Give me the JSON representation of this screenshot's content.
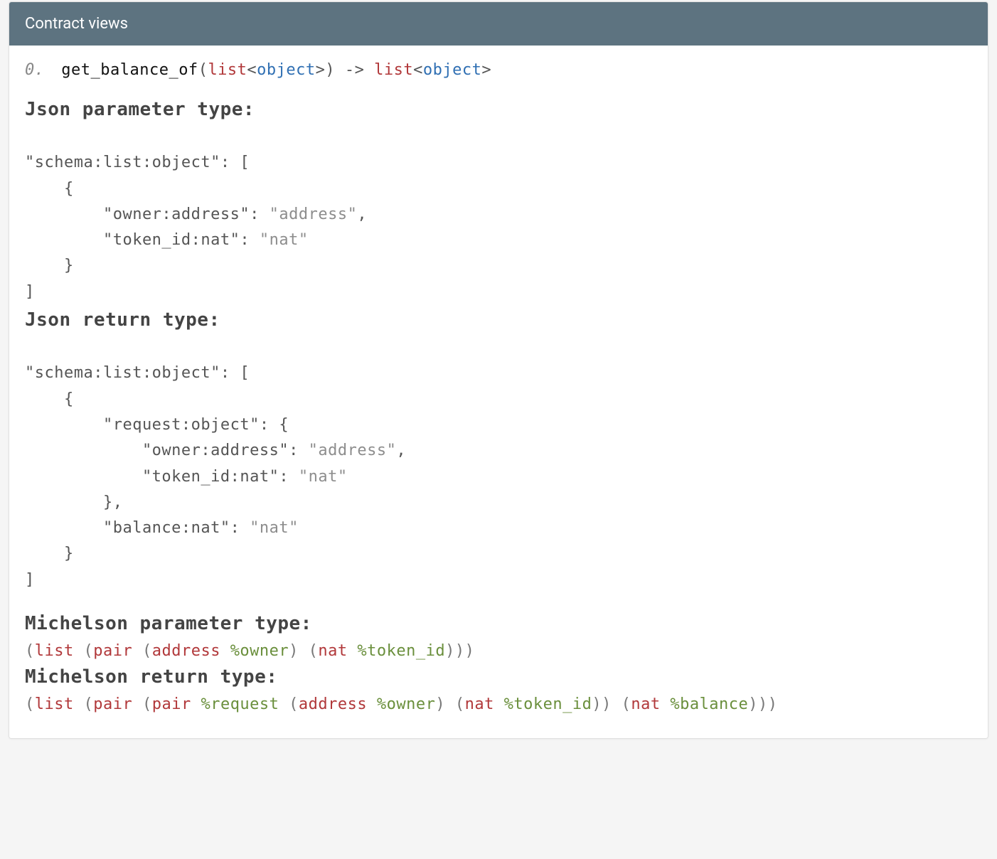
{
  "header": {
    "title": "Contract views"
  },
  "signature": {
    "index": "0.",
    "name": "get_balance_of",
    "p_open": "(",
    "p_close": ")",
    "list_kw": "list",
    "lt": "<",
    "gt": ">",
    "object_kw": "object",
    "arrow": " -> "
  },
  "sections": {
    "json_param_title": "Json parameter type:",
    "json_return_title": "Json return type:",
    "mich_param_title": "Michelson parameter type:",
    "mich_return_title": "Michelson return type:"
  },
  "json_param": {
    "l1a": "\"schema:list:object\"",
    "l1b": ": [",
    "l2": "    {",
    "l3a": "        \"owner:address\"",
    "l3b": ": ",
    "l3c": "\"address\"",
    "l3d": ",",
    "l4a": "        \"token_id:nat\"",
    "l4b": ": ",
    "l4c": "\"nat\"",
    "l5": "    }",
    "l6": "]"
  },
  "json_return": {
    "l1a": "\"schema:list:object\"",
    "l1b": ": [",
    "l2": "    {",
    "l3a": "        \"request:object\"",
    "l3b": ": {",
    "l4a": "            \"owner:address\"",
    "l4b": ": ",
    "l4c": "\"address\"",
    "l4d": ",",
    "l5a": "            \"token_id:nat\"",
    "l5b": ": ",
    "l5c": "\"nat\"",
    "l6": "        },",
    "l7a": "        \"balance:nat\"",
    "l7b": ": ",
    "l7c": "\"nat\"",
    "l8": "    }",
    "l9": "]"
  },
  "mich_param": {
    "t1": "(",
    "t2": "list",
    "t3": " (",
    "t4": "pair",
    "t5": " (",
    "t6": "address",
    "t7": " ",
    "t8": "%owner",
    "t9": ") (",
    "t10": "nat",
    "t11": " ",
    "t12": "%token_id",
    "t13": ")))"
  },
  "mich_return": {
    "t1": "(",
    "t2": "list",
    "t3": " (",
    "t4": "pair",
    "t5": " (",
    "t6": "pair",
    "t7": " ",
    "t8": "%request",
    "t9": " (",
    "t10": "address",
    "t11": " ",
    "t12": "%owner",
    "t13": ") (",
    "t14": "nat",
    "t15": " ",
    "t16": "%token_id",
    "t17": ")) (",
    "t18": "nat",
    "t19": " ",
    "t20": "%balance",
    "t21": ")))"
  }
}
